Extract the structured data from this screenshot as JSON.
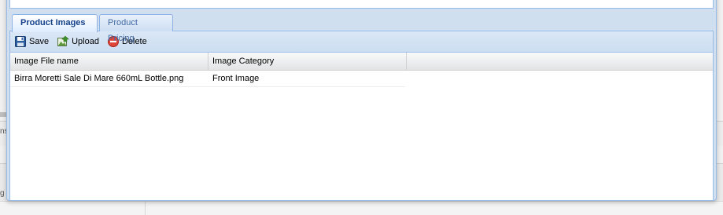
{
  "tabs": [
    {
      "label": "Product Images",
      "active": true
    },
    {
      "label": "Product Pricing",
      "active": false
    }
  ],
  "toolbar": {
    "save_label": "Save",
    "upload_label": "Upload",
    "delete_label": "Delete"
  },
  "grid": {
    "columns": [
      "Image File name",
      "Image Category"
    ],
    "rows": [
      [
        "Birra Moretti Sale Di Mare 660mL Bottle.png",
        "Front Image"
      ]
    ]
  },
  "background": {
    "glyph_1": "ns",
    "glyph_2": "g"
  },
  "colors": {
    "accent": "#15428b",
    "border": "#99bbe8",
    "toolbar_bg": "#cddef1"
  },
  "icons": {
    "save": "floppy-disk-icon",
    "upload": "upload-image-icon",
    "delete": "delete-circle-icon"
  }
}
